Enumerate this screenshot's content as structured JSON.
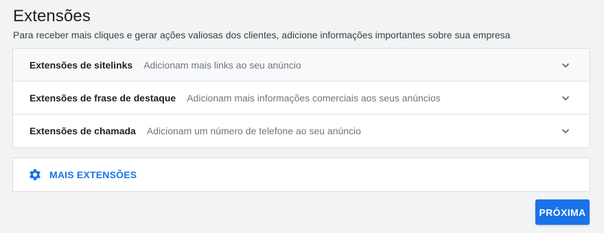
{
  "header": {
    "title": "Extensões",
    "subtitle": "Para receber mais cliques e gerar ações valiosas dos clientes, adicione informações importantes sobre sua empresa"
  },
  "extensions": [
    {
      "label": "Extensões de sitelinks",
      "description": "Adicionam mais links ao seu anúncio",
      "icon": "chevron-down-icon"
    },
    {
      "label": "Extensões de frase de destaque",
      "description": "Adicionam mais informações comerciais aos seus anúncios",
      "icon": "chevron-down-icon"
    },
    {
      "label": "Extensões de chamada",
      "description": "Adicionam um número de telefone ao seu anúncio",
      "icon": "chevron-down-icon"
    }
  ],
  "more": {
    "label": "MAIS EXTENSÕES",
    "icon": "gear-icon"
  },
  "actions": {
    "next_label": "PRÓXIMA"
  },
  "colors": {
    "accent": "#1a73e8",
    "background": "#f1f3f4"
  }
}
